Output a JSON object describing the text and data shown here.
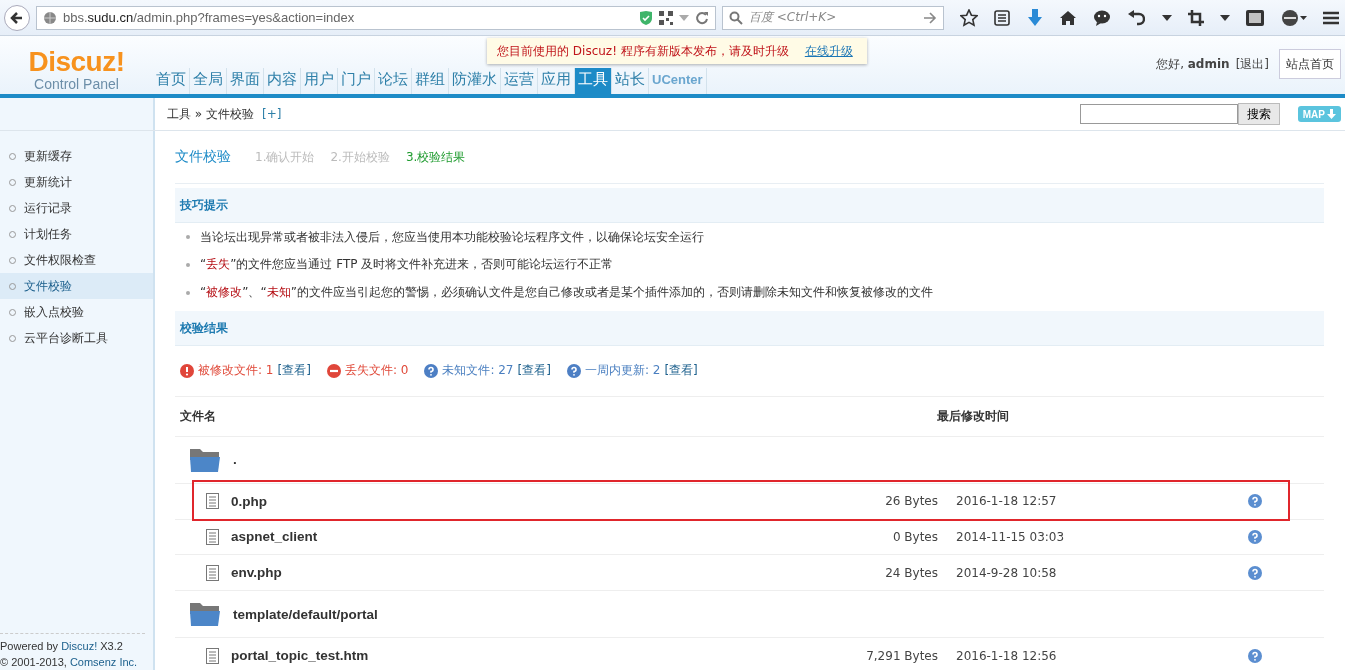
{
  "browser": {
    "url_host": "bbs.",
    "url_domain": "sudu.cn",
    "url_path": "/admin.php?frames=yes&action=index",
    "search_placeholder": "百度 <Ctrl+K>"
  },
  "notice": {
    "text": "您目前使用的 Discuz! 程序有新版本发布，请及时升级",
    "link": "在线升级"
  },
  "logo": {
    "title": "Discuz!",
    "subtitle": "Control Panel"
  },
  "nav": [
    {
      "label": "首页",
      "selected": false
    },
    {
      "label": "全局",
      "selected": false
    },
    {
      "label": "界面",
      "selected": false
    },
    {
      "label": "内容",
      "selected": false
    },
    {
      "label": "用户",
      "selected": false
    },
    {
      "label": "门户",
      "selected": false
    },
    {
      "label": "论坛",
      "selected": false
    },
    {
      "label": "群组",
      "selected": false
    },
    {
      "label": "防灌水",
      "selected": false
    },
    {
      "label": "运营",
      "selected": false
    },
    {
      "label": "应用",
      "selected": false
    },
    {
      "label": "工具",
      "selected": true
    },
    {
      "label": "站长",
      "selected": false
    },
    {
      "label": "UCenter",
      "selected": false
    }
  ],
  "user": {
    "greeting": "您好,",
    "name": "admin",
    "logout": "[退出]",
    "home_button": "站点首页"
  },
  "breadcrumb": {
    "section": "工具",
    "separator": "»",
    "page": "文件校验",
    "add": "[+]"
  },
  "search": {
    "button": "搜索",
    "map_button": "MAP"
  },
  "sidebar": [
    {
      "label": "更新缓存",
      "selected": false
    },
    {
      "label": "更新统计",
      "selected": false
    },
    {
      "label": "运行记录",
      "selected": false
    },
    {
      "label": "计划任务",
      "selected": false
    },
    {
      "label": "文件权限检查",
      "selected": false
    },
    {
      "label": "文件校验",
      "selected": true
    },
    {
      "label": "嵌入点校验",
      "selected": false
    },
    {
      "label": "云平台诊断工具",
      "selected": false
    }
  ],
  "footer": {
    "powered": "Powered by",
    "brand": "Discuz!",
    "version": "X3.2",
    "copyright": "© 2001-2013,",
    "company": "Comsenz Inc."
  },
  "page_title": "文件校验",
  "steps": [
    {
      "label": "1.确认开始",
      "selected": false
    },
    {
      "label": "2.开始校验",
      "selected": false
    },
    {
      "label": "3.校验结果",
      "selected": true
    }
  ],
  "tips_title": "技巧提示",
  "tips": [
    [
      {
        "text": "当论坛出现异常或者被非法入侵后，您应当使用本功能校验论坛程序文件，以确保论坛安全运行",
        "kind": "plain"
      }
    ],
    [
      {
        "text": "“",
        "kind": "plain"
      },
      {
        "text": "丢失",
        "kind": "warn"
      },
      {
        "text": "”的文件您应当通过 FTP 及时将文件补充进来，否则可能论坛运行不正常",
        "kind": "plain"
      }
    ],
    [
      {
        "text": "“",
        "kind": "plain"
      },
      {
        "text": "被修改",
        "kind": "warn"
      },
      {
        "text": "”、“",
        "kind": "plain"
      },
      {
        "text": "未知",
        "kind": "warn"
      },
      {
        "text": "”的文件应当引起您的警惕，必须确认文件是您自己修改或者是某个插件添加的，否则请删除未知文件和恢复被修改的文件",
        "kind": "plain"
      }
    ]
  ],
  "results_title": "校验结果",
  "stats": [
    {
      "kind": "modified",
      "label": "被修改文件: 1",
      "link": "[查看]"
    },
    {
      "kind": "missing",
      "label": "丢失文件: 0"
    },
    {
      "kind": "unknown",
      "label": "未知文件: 27",
      "link": "[查看]"
    },
    {
      "kind": "unknown",
      "label": "一周内更新: 2",
      "link": "[查看]"
    }
  ],
  "table": {
    "columns": [
      "文件名",
      "最后修改时间"
    ],
    "rows": [
      {
        "kind": "folder",
        "name": "."
      },
      {
        "kind": "file",
        "name": "0.php",
        "size": "26 Bytes",
        "time": "2016-1-18 12:57",
        "highlighted": true
      },
      {
        "kind": "file",
        "name": "aspnet_client",
        "size": "0 Bytes",
        "time": "2014-11-15 03:03",
        "highlighted": false
      },
      {
        "kind": "file",
        "name": "env.php",
        "size": "24 Bytes",
        "time": "2014-9-28 10:58",
        "highlighted": false
      },
      {
        "kind": "folder",
        "name": "template/default/portal"
      },
      {
        "kind": "file",
        "name": "portal_topic_test.htm",
        "size": "7,291 Bytes",
        "time": "2016-1-18 12:56",
        "highlighted": false
      }
    ]
  }
}
